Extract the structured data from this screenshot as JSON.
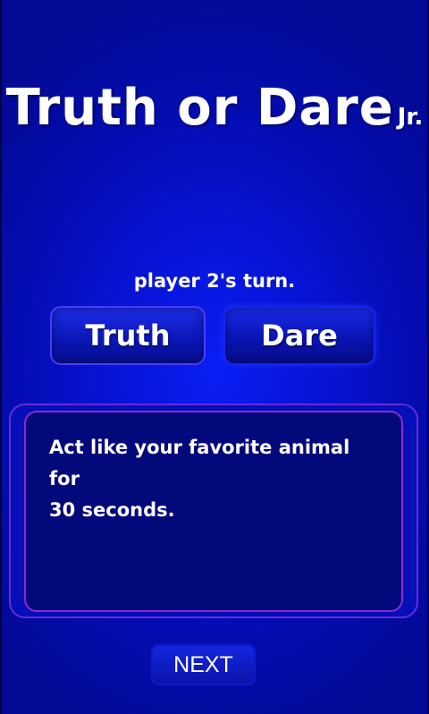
{
  "app": {
    "title": "Truth or Dare",
    "title_suffix": "Jr."
  },
  "game": {
    "turn_text": "player 2's turn."
  },
  "buttons": {
    "truth_label": "Truth",
    "dare_label": "Dare",
    "next_label": "NEXT"
  },
  "card": {
    "prompt_line1": "Act like your favorite animal for",
    "prompt_line2": "30 seconds."
  },
  "colors": {
    "background": "#0714d6",
    "card_background": "#03087a",
    "card_border": "#8a2ad0",
    "text": "#ffffff"
  }
}
